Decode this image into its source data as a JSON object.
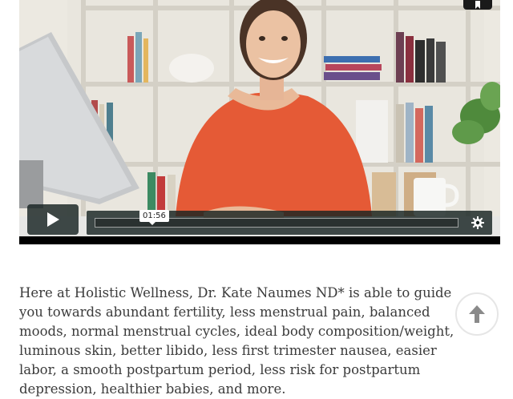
{
  "video": {
    "current_time": "01:56",
    "play_icon": "play-icon",
    "settings_icon": "gear-icon",
    "bookmark_icon": "bookmark-icon",
    "accent_color": "#172322"
  },
  "article": {
    "paragraph": "Here at Holistic Wellness, Dr. Kate Naumes ND* is able to guide you towards abundant fertility, less menstrual pain, balanced moods, normal menstrual cycles, ideal body composition/weight, luminous skin, better libido, less first trimester nausea, easier labor, a smooth postpartum period, less risk for postpartum depression, healthier babies, and more."
  },
  "back_to_top": {
    "icon": "arrow-up-icon"
  }
}
